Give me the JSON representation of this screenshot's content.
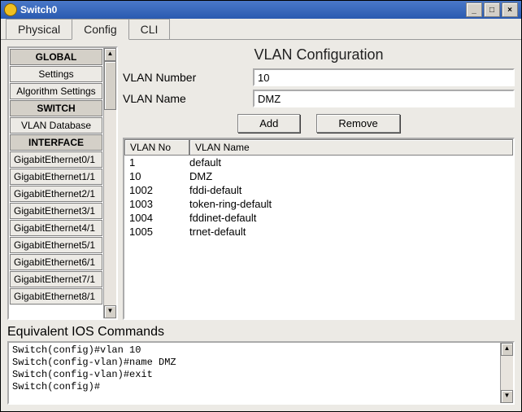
{
  "window": {
    "title": "Switch0"
  },
  "tabs": {
    "physical": "Physical",
    "config": "Config",
    "cli": "CLI"
  },
  "sidebar": {
    "global_hdr": "GLOBAL",
    "settings": "Settings",
    "algo": "Algorithm Settings",
    "switch_hdr": "SWITCH",
    "vlan_db": "VLAN Database",
    "interface_hdr": "INTERFACE",
    "ifs": [
      "GigabitEthernet0/1",
      "GigabitEthernet1/1",
      "GigabitEthernet2/1",
      "GigabitEthernet3/1",
      "GigabitEthernet4/1",
      "GigabitEthernet5/1",
      "GigabitEthernet6/1",
      "GigabitEthernet7/1",
      "GigabitEthernet8/1"
    ]
  },
  "vlan": {
    "section_title": "VLAN Configuration",
    "number_label": "VLAN Number",
    "number_value": "10",
    "name_label": "VLAN Name",
    "name_value": "DMZ",
    "add_btn": "Add",
    "remove_btn": "Remove",
    "col_no": "VLAN No",
    "col_name": "VLAN Name",
    "rows": [
      {
        "no": "1",
        "name": "default"
      },
      {
        "no": "10",
        "name": "DMZ"
      },
      {
        "no": "1002",
        "name": "fddi-default"
      },
      {
        "no": "1003",
        "name": "token-ring-default"
      },
      {
        "no": "1004",
        "name": "fddinet-default"
      },
      {
        "no": "1005",
        "name": "trnet-default"
      }
    ]
  },
  "ios": {
    "title": "Equivalent IOS Commands",
    "lines": "Switch(config)#vlan 10\nSwitch(config-vlan)#name DMZ\nSwitch(config-vlan)#exit\nSwitch(config)#"
  }
}
